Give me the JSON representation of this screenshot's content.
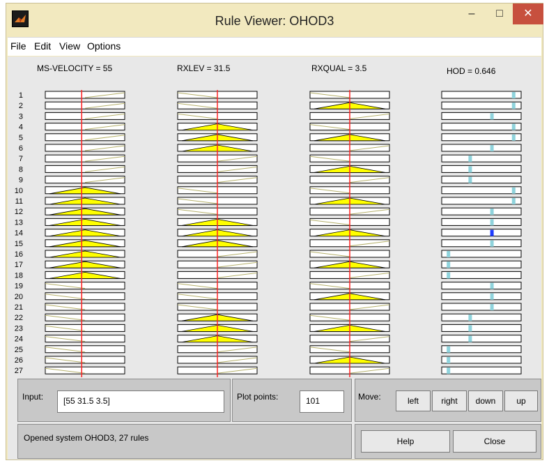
{
  "window": {
    "title": "Rule Viewer: OHOD3"
  },
  "titlebar_buttons": {
    "minimize": "–",
    "maximize": "□",
    "close": "✕"
  },
  "menu": [
    "File",
    "Edit",
    "View",
    "Options"
  ],
  "variables": [
    {
      "title": "MS-VELOCITY = 55",
      "kind": "input"
    },
    {
      "title": "RXLEV = 31.5",
      "kind": "input"
    },
    {
      "title": "RXQUAL = 3.5",
      "kind": "input"
    },
    {
      "title": "HOD = 0.646",
      "kind": "output"
    }
  ],
  "rules": {
    "labels": [
      "1",
      "2",
      "3",
      "4",
      "5",
      "6",
      "7",
      "8",
      "9",
      "10",
      "11",
      "12",
      "13",
      "14",
      "15",
      "16",
      "17",
      "18",
      "19",
      "20",
      "21",
      "22",
      "23",
      "24",
      "25",
      "26",
      "27"
    ],
    "input_mf": [
      [
        "high",
        "low",
        "low"
      ],
      [
        "high",
        "low",
        "med"
      ],
      [
        "high",
        "low",
        "high"
      ],
      [
        "high",
        "med",
        "low"
      ],
      [
        "high",
        "med",
        "med"
      ],
      [
        "high",
        "med",
        "high"
      ],
      [
        "high",
        "high",
        "low"
      ],
      [
        "high",
        "high",
        "med"
      ],
      [
        "high",
        "high",
        "high"
      ],
      [
        "med",
        "low",
        "low"
      ],
      [
        "med",
        "low",
        "med"
      ],
      [
        "med",
        "low",
        "high"
      ],
      [
        "med",
        "med",
        "low"
      ],
      [
        "med",
        "med",
        "med"
      ],
      [
        "med",
        "med",
        "high"
      ],
      [
        "med",
        "high",
        "low"
      ],
      [
        "med",
        "high",
        "med"
      ],
      [
        "med",
        "high",
        "high"
      ],
      [
        "low",
        "low",
        "low"
      ],
      [
        "low",
        "low",
        "med"
      ],
      [
        "low",
        "low",
        "high"
      ],
      [
        "low",
        "med",
        "low"
      ],
      [
        "low",
        "med",
        "med"
      ],
      [
        "low",
        "med",
        "high"
      ],
      [
        "low",
        "high",
        "low"
      ],
      [
        "low",
        "high",
        "med"
      ],
      [
        "low",
        "high",
        "high"
      ]
    ],
    "output_level": [
      0.95,
      0.95,
      0.65,
      0.95,
      0.95,
      0.65,
      0.35,
      0.35,
      0.35,
      0.95,
      0.95,
      0.65,
      0.65,
      0.65,
      0.65,
      0.05,
      0.05,
      0.05,
      0.65,
      0.65,
      0.65,
      0.35,
      0.35,
      0.35,
      0.05,
      0.05,
      0.05
    ],
    "highlighted_output_rule": "14"
  },
  "input_markers": [
    55,
    31.5,
    3.5
  ],
  "input_ranges": [
    [
      0,
      120
    ],
    [
      0,
      63
    ],
    [
      0,
      7
    ]
  ],
  "colors": {
    "fill": "#ffff00",
    "marker": "#ff2222",
    "output": "#8fd3dc",
    "output_active": "#1f3cff"
  },
  "input_panel": {
    "label": "Input:",
    "value": "[55 31.5 3.5]"
  },
  "plot_points": {
    "label": "Plot points:",
    "value": "101"
  },
  "move": {
    "label": "Move:",
    "left": "left",
    "right": "right",
    "down": "down",
    "up": "up"
  },
  "status": "Opened system OHOD3, 27 rules",
  "help_label": "Help",
  "close_label": "Close"
}
